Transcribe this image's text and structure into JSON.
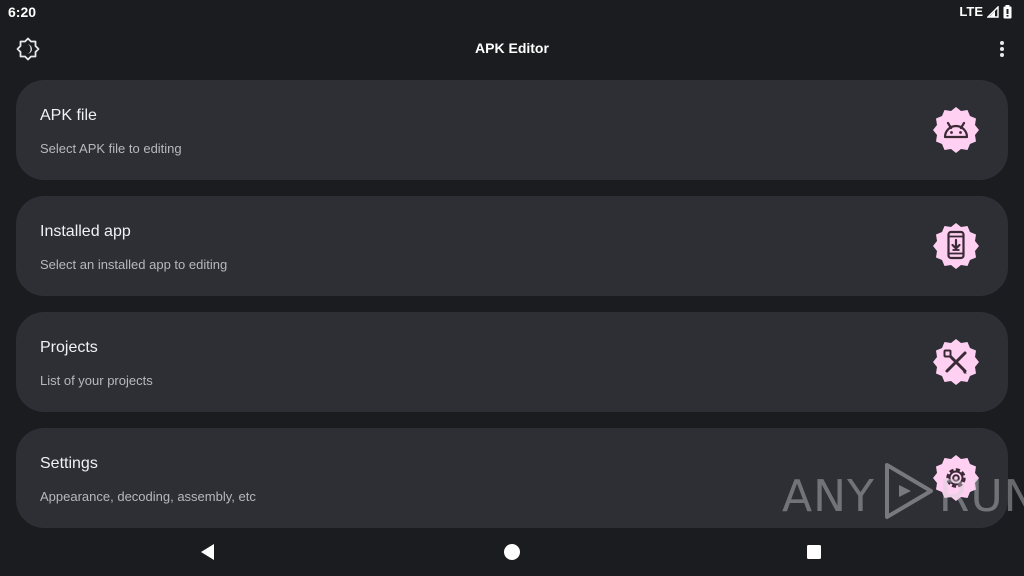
{
  "status_bar": {
    "time": "6:20",
    "network": "LTE",
    "icons": [
      "signal-icon",
      "battery-icon"
    ]
  },
  "app_bar": {
    "title": "APK Editor",
    "left_icon": "brightness-icon",
    "right_icon": "more-vert-icon"
  },
  "menu_items": [
    {
      "title": "APK file",
      "subtitle": "Select APK file to editing",
      "icon": "android-icon"
    },
    {
      "title": "Installed app",
      "subtitle": "Select an installed app to editing",
      "icon": "phone-download-icon"
    },
    {
      "title": "Projects",
      "subtitle": "List of your projects",
      "icon": "tools-icon"
    },
    {
      "title": "Settings",
      "subtitle": "Appearance, decoding, assembly, etc",
      "icon": "gear-icon"
    }
  ],
  "watermark": {
    "left": "ANY",
    "right": "RUN"
  },
  "nav_bar": {
    "icons": [
      "back-icon",
      "home-icon",
      "recents-icon"
    ]
  },
  "colors": {
    "background": "#1b1c20",
    "card": "#2e2f35",
    "icon_badge": "#ffd0f2",
    "icon_glyph": "#3a2a36"
  }
}
